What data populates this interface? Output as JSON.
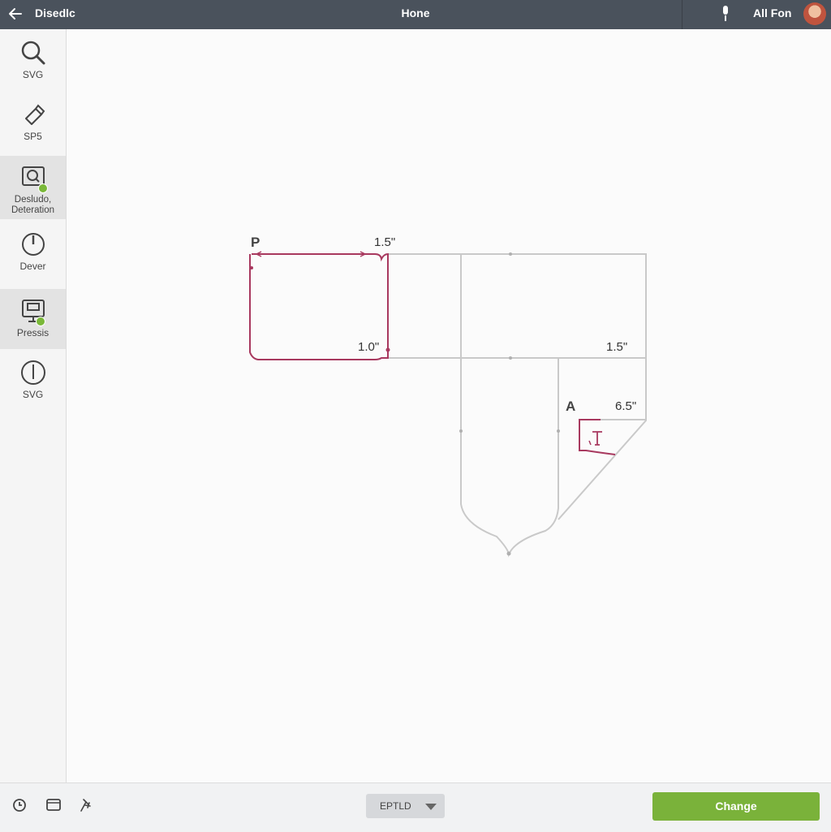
{
  "header": {
    "app_title": "Disedlc",
    "center_title": "Hone",
    "user_name": "All Fon"
  },
  "sidebar": {
    "items": [
      {
        "label": "SVG",
        "icon": "search-icon"
      },
      {
        "label": "SP5",
        "icon": "pen-icon"
      },
      {
        "label": "Desludo, Deteration",
        "icon": "inspect-icon",
        "active": true,
        "badge": true
      },
      {
        "label": "Dever",
        "icon": "power-icon"
      },
      {
        "label": "Pressis",
        "icon": "layers-icon",
        "active": true,
        "badge": true
      },
      {
        "label": "SVG",
        "icon": "circle-line-icon"
      }
    ]
  },
  "canvas": {
    "labels": {
      "p": "P",
      "a": "A",
      "dim_top": "1.5\"",
      "dim_left_bottom": "1.0\"",
      "dim_right": "1.5\"",
      "dim_small": "6.5\""
    }
  },
  "footer": {
    "format_value": "EPTLD",
    "change_label": "Change",
    "icons": [
      "clock-icon",
      "monitor-icon",
      "pin-icon"
    ]
  },
  "colors": {
    "accent": "#7ab23a",
    "topbar": "#4a525c",
    "cut_line": "#a8395f",
    "guide_line": "#c9c9c9"
  }
}
